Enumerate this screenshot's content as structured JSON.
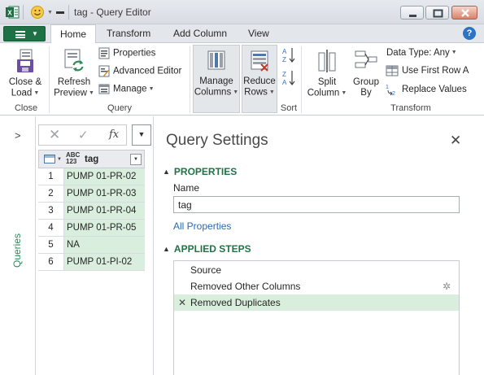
{
  "window": {
    "title": "tag - Query Editor"
  },
  "ribbon": {
    "tabs": {
      "home": "Home",
      "transform": "Transform",
      "add_column": "Add Column",
      "view": "View"
    },
    "active_tab": "Home",
    "close_group": {
      "close_load": [
        "Close &",
        "Load"
      ],
      "label": "Close"
    },
    "query_group": {
      "refresh_preview": [
        "Refresh",
        "Preview"
      ],
      "properties": "Properties",
      "advanced_editor": "Advanced Editor",
      "manage": "Manage",
      "label": "Query"
    },
    "manage_columns": [
      "Manage",
      "Columns"
    ],
    "reduce_rows": [
      "Reduce",
      "Rows"
    ],
    "sort_group": {
      "label": "Sort"
    },
    "transform_group": {
      "split_column": [
        "Split",
        "Column"
      ],
      "group_by": [
        "Group",
        "By"
      ],
      "data_type": "Data Type: Any",
      "use_first_row": "Use First Row A",
      "replace_values": "Replace Values",
      "label": "Transform"
    }
  },
  "queries_pane": {
    "label": "Queries"
  },
  "formula_bar": {
    "fx": "fx"
  },
  "grid": {
    "column_type": [
      "ABC",
      "123"
    ],
    "column_name": "tag",
    "rows": [
      {
        "n": "1",
        "tag": "PUMP 01-PR-02"
      },
      {
        "n": "2",
        "tag": "PUMP 01-PR-03"
      },
      {
        "n": "3",
        "tag": "PUMP 01-PR-04"
      },
      {
        "n": "4",
        "tag": "PUMP 01-PR-05"
      },
      {
        "n": "5",
        "tag": "NA"
      },
      {
        "n": "6",
        "tag": "PUMP 01-PI-02"
      }
    ]
  },
  "query_settings": {
    "title": "Query Settings",
    "properties_header": "PROPERTIES",
    "name_label": "Name",
    "name_value": "tag",
    "all_properties": "All Properties",
    "applied_steps_header": "APPLIED STEPS",
    "steps": [
      "Source",
      "Removed Other Columns",
      "Removed Duplicates"
    ],
    "active_step": "Removed Duplicates"
  },
  "colors": {
    "accent_green": "#217346",
    "selection_green": "#d9eedd",
    "link_blue": "#2a6bb0"
  }
}
